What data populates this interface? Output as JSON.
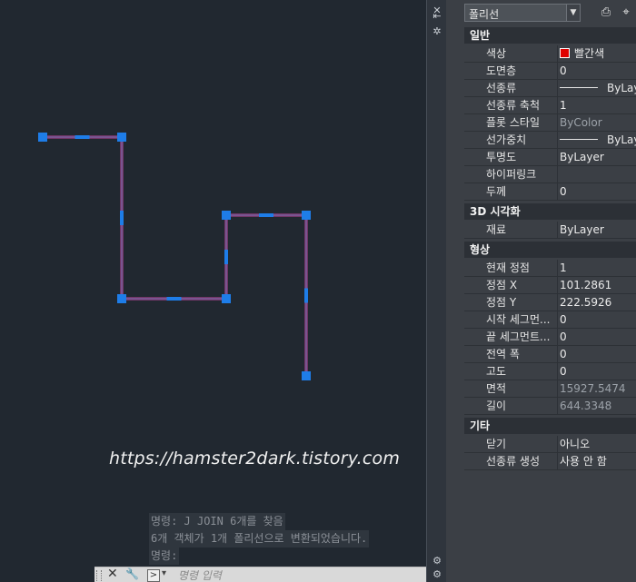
{
  "watermark": "https://hamster2dark.tistory.com",
  "command_history": [
    "명령: J JOIN 6개를 찾음",
    "6개 객체가 1개 폴리선으로 변환되었습니다.",
    "명령:"
  ],
  "command_input_placeholder": "명령 입력",
  "colors": {
    "polyline": "#8a3a78",
    "grip": "#1e7de8",
    "background": "#212830",
    "color_swatch": "#e00000"
  },
  "polyline_vertices_count": 7,
  "properties": {
    "selection": "폴리선",
    "sections": {
      "general": {
        "title": "일반",
        "rows": [
          {
            "label": "색상",
            "value": "빨간색"
          },
          {
            "label": "도면층",
            "value": "0"
          },
          {
            "label": "선종류",
            "value": "ByLayer"
          },
          {
            "label": "선종류 축척",
            "value": "1"
          },
          {
            "label": "플롯 스타일",
            "value": "ByColor"
          },
          {
            "label": "선가중치",
            "value": "ByLayer"
          },
          {
            "label": "투명도",
            "value": "ByLayer"
          },
          {
            "label": "하이퍼링크",
            "value": ""
          },
          {
            "label": "두께",
            "value": "0"
          }
        ]
      },
      "viz3d": {
        "title": "3D 시각화",
        "rows": [
          {
            "label": "재료",
            "value": "ByLayer"
          }
        ]
      },
      "geometry": {
        "title": "형상",
        "rows": [
          {
            "label": "현재 정점",
            "value": "1"
          },
          {
            "label": "정점 X",
            "value": "101.2861"
          },
          {
            "label": "정점 Y",
            "value": "222.5926"
          },
          {
            "label": "시작 세그먼...",
            "value": "0"
          },
          {
            "label": "끝 세그먼트...",
            "value": "0"
          },
          {
            "label": "전역 폭",
            "value": "0"
          },
          {
            "label": "고도",
            "value": "0"
          },
          {
            "label": "면적",
            "value": "15927.5474"
          },
          {
            "label": "길이",
            "value": "644.3348"
          }
        ]
      },
      "misc": {
        "title": "기타",
        "rows": [
          {
            "label": "닫기",
            "value": "아니오"
          },
          {
            "label": "선종류 생성",
            "value": "사용 안 함"
          }
        ]
      }
    }
  }
}
